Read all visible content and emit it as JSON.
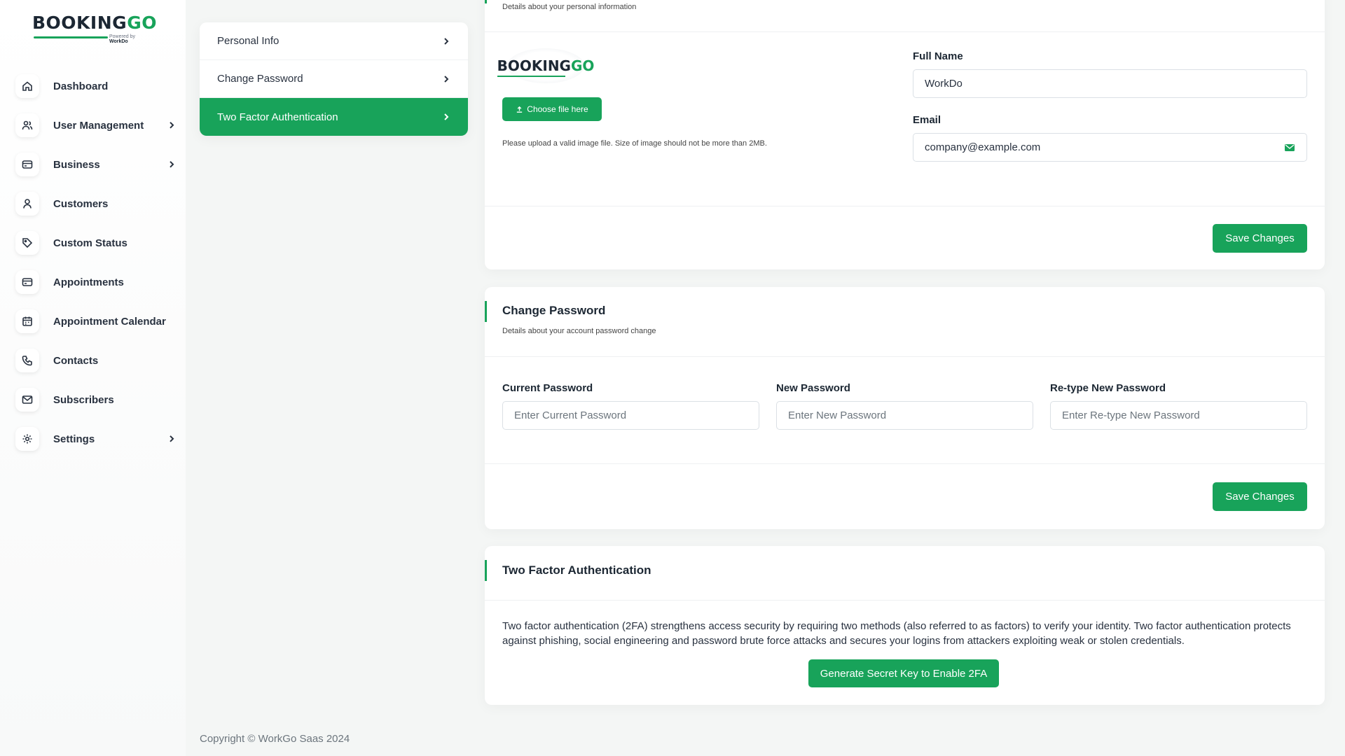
{
  "brand": {
    "logo_text_a": "BOOKING",
    "logo_text_b": "GO",
    "powered_by": "Powered by",
    "powered_brand": "WorkDo"
  },
  "sidebar": {
    "items": [
      {
        "label": "Dashboard",
        "icon": "home-icon",
        "has_chevron": false
      },
      {
        "label": "User Management",
        "icon": "users-icon",
        "has_chevron": true
      },
      {
        "label": "Business",
        "icon": "card-icon",
        "has_chevron": true
      },
      {
        "label": "Customers",
        "icon": "user-icon",
        "has_chevron": false
      },
      {
        "label": "Custom Status",
        "icon": "tag-icon",
        "has_chevron": false
      },
      {
        "label": "Appointments",
        "icon": "card-icon",
        "has_chevron": false
      },
      {
        "label": "Appointment Calendar",
        "icon": "calendar-icon",
        "has_chevron": false
      },
      {
        "label": "Contacts",
        "icon": "phone-icon",
        "has_chevron": false
      },
      {
        "label": "Subscribers",
        "icon": "mail-icon",
        "has_chevron": false
      },
      {
        "label": "Settings",
        "icon": "gear-icon",
        "has_chevron": true
      }
    ]
  },
  "settings_menu": {
    "items": [
      {
        "label": "Personal Info",
        "active": false
      },
      {
        "label": "Change Password",
        "active": false
      },
      {
        "label": "Two Factor Authentication",
        "active": true
      }
    ]
  },
  "personal_info": {
    "subtitle": "Details about your personal information",
    "choose_file_label": "Choose file here",
    "upload_hint": "Please upload a valid image file. Size of image should not be more than 2MB.",
    "full_name_label": "Full Name",
    "full_name_value": "WorkDo",
    "email_label": "Email",
    "email_value": "company@example.com",
    "save_label": "Save Changes"
  },
  "change_password": {
    "title": "Change Password",
    "subtitle": "Details about your account password change",
    "current_label": "Current Password",
    "current_placeholder": "Enter Current Password",
    "new_label": "New Password",
    "new_placeholder": "Enter New Password",
    "retype_label": "Re-type New Password",
    "retype_placeholder": "Enter Re-type New Password",
    "save_label": "Save Changes"
  },
  "two_factor": {
    "title": "Two Factor Authentication",
    "description": "Two factor authentication (2FA) strengthens access security by requiring two methods (also referred to as factors) to verify your identity. Two factor authentication protects against phishing, social engineering and password brute force attacks and secures your logins from attackers exploiting weak or stolen credentials.",
    "button_label": "Generate Secret Key to Enable 2FA"
  },
  "footer": {
    "copyright": "Copyright © WorkGo Saas 2024"
  },
  "colors": {
    "accent": "#18a35a",
    "text": "#293240",
    "background": "#f4f6f5"
  }
}
